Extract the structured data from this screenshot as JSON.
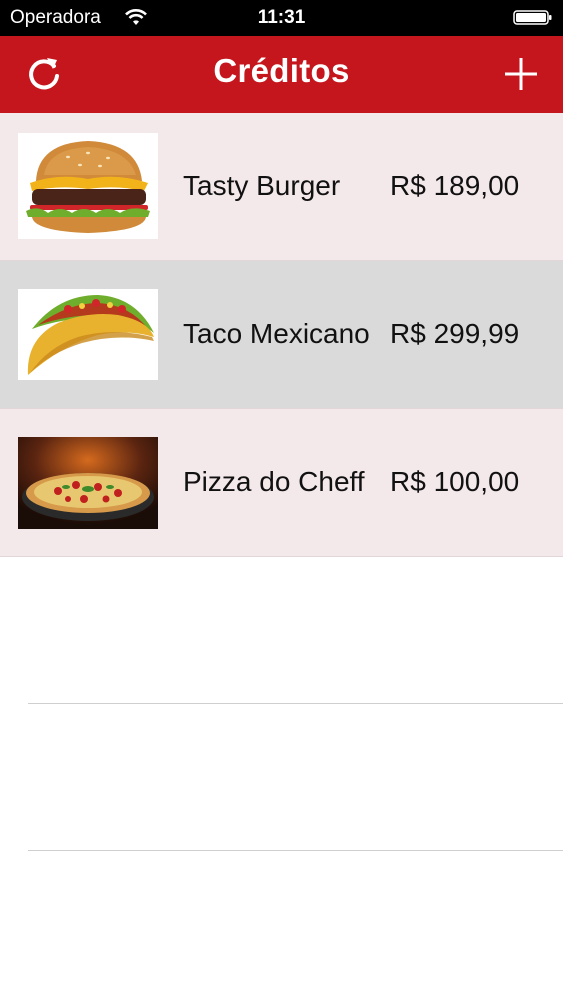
{
  "status_bar": {
    "carrier": "Operadora",
    "time": "11:31"
  },
  "nav": {
    "title": "Créditos",
    "left_icon": "refresh-icon",
    "right_icon": "plus-icon"
  },
  "colors": {
    "nav_background": "#c4161c",
    "row_background": "#f3e8ea",
    "row_selected_background": "#dadada"
  },
  "items": [
    {
      "name": "Tasty Burger",
      "price": "R$ 189,00",
      "image": "burger-image",
      "selected": false
    },
    {
      "name": "Taco Mexicano",
      "price": "R$ 299,99",
      "image": "taco-image",
      "selected": true
    },
    {
      "name": "Pizza do Cheff",
      "price": "R$ 100,00",
      "image": "pizza-image",
      "selected": false
    }
  ]
}
